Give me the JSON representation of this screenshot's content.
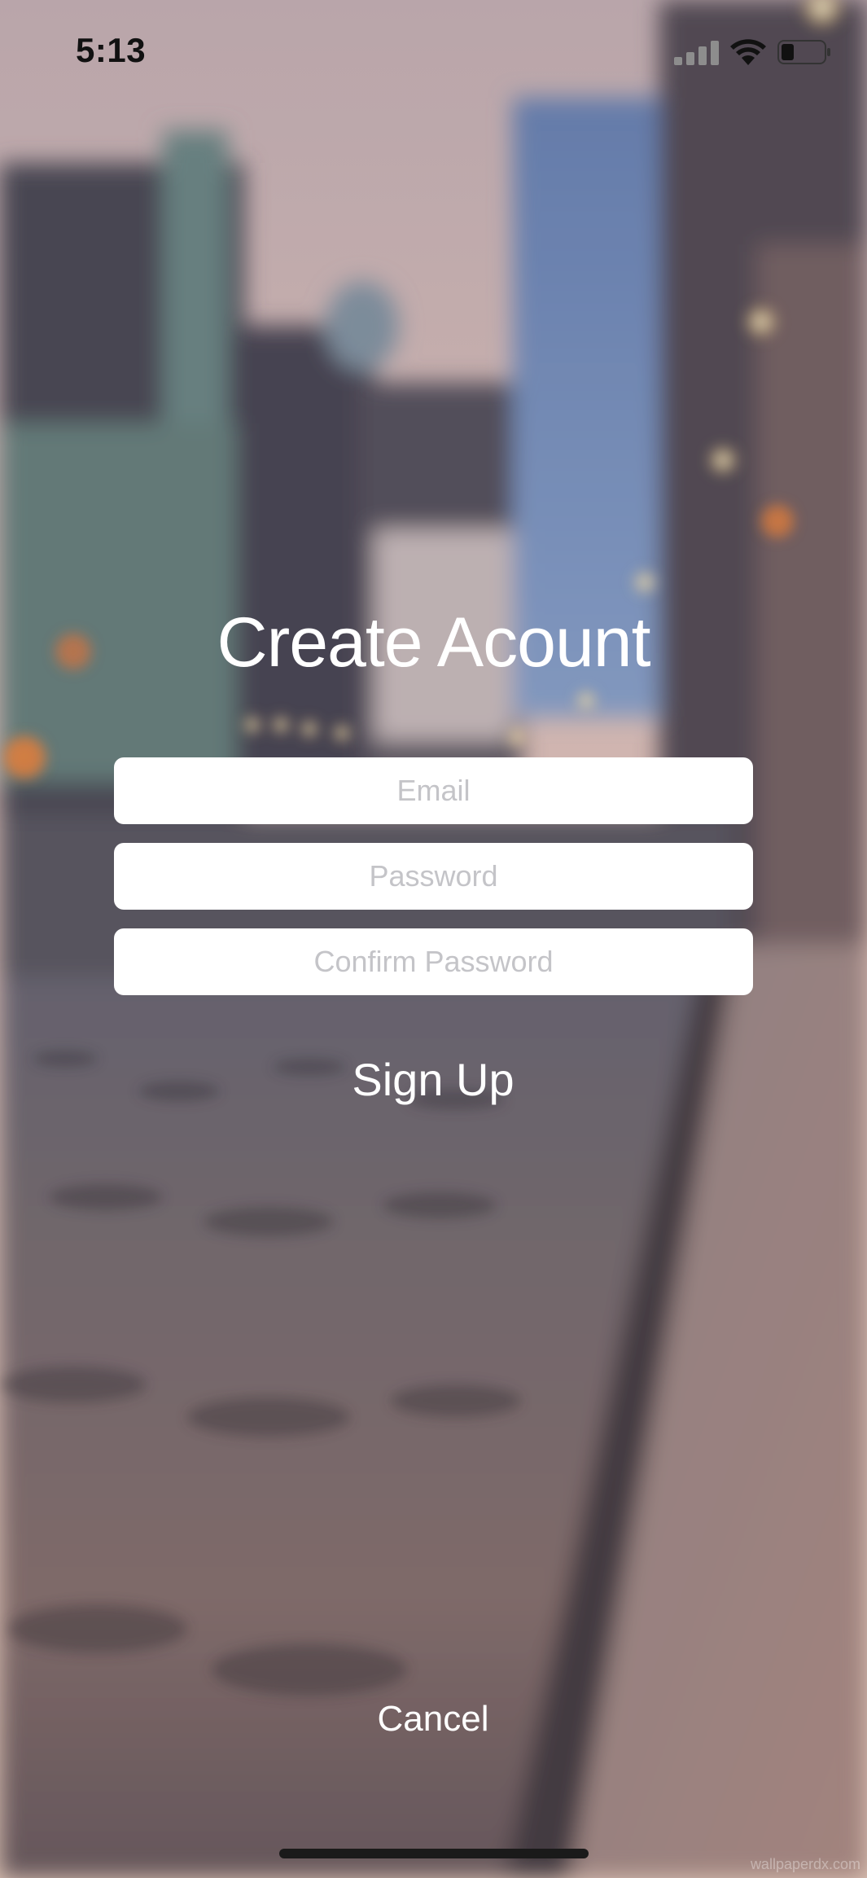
{
  "status_bar": {
    "time": "5:13",
    "signal_icon": "cellular-signal-icon",
    "wifi_icon": "wifi-icon",
    "battery_icon": "battery-icon",
    "battery_level": 0.3
  },
  "header": {
    "title": "Create Acount"
  },
  "form": {
    "email_placeholder": "Email",
    "email_value": "",
    "password_placeholder": "Password",
    "password_value": "",
    "confirm_password_placeholder": "Confirm Password",
    "confirm_password_value": "",
    "signup_label": "Sign Up"
  },
  "footer": {
    "cancel_label": "Cancel"
  },
  "background": {
    "watermark": "wallpaperdx.com"
  },
  "colors": {
    "text_on_background": "#ffffff",
    "field_background": "#ffffff",
    "placeholder": "#c4c4c8"
  }
}
